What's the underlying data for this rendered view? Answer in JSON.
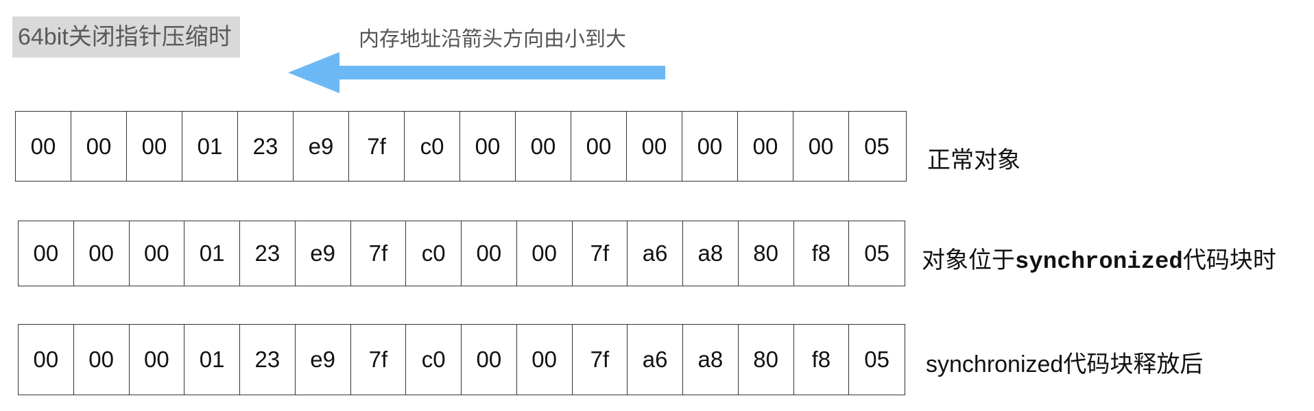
{
  "title": "64bit关闭指针压缩时",
  "arrow_label": "内存地址沿箭头方向由小到大",
  "colors": {
    "arrow": "#6cb8f4",
    "title_bg": "#d9d9d9"
  },
  "rows": [
    {
      "label": "正常对象",
      "bytes": [
        "00",
        "00",
        "00",
        "01",
        "23",
        "e9",
        "7f",
        "c0",
        "00",
        "00",
        "00",
        "00",
        "00",
        "00",
        "00",
        "05"
      ]
    },
    {
      "label_parts": [
        "对象位于",
        "synchronized",
        "代码块时"
      ],
      "bytes": [
        "00",
        "00",
        "00",
        "01",
        "23",
        "e9",
        "7f",
        "c0",
        "00",
        "00",
        "7f",
        "a6",
        "a8",
        "80",
        "f8",
        "05"
      ]
    },
    {
      "label": "synchronized代码块释放后",
      "bytes": [
        "00",
        "00",
        "00",
        "01",
        "23",
        "e9",
        "7f",
        "c0",
        "00",
        "00",
        "7f",
        "a6",
        "a8",
        "80",
        "f8",
        "05"
      ]
    }
  ]
}
